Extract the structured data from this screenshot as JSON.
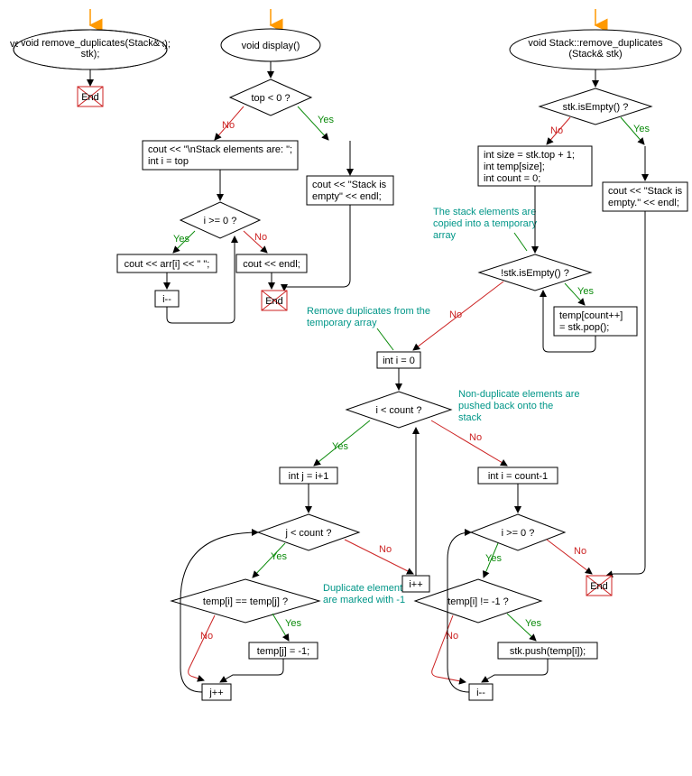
{
  "flowchart1": {
    "header": "void remove_duplicates(Stack& stk);",
    "end": "End"
  },
  "flowchart2": {
    "header": "void display()",
    "cond1": "top < 0 ?",
    "box_left": "cout << \"\\nStack elements are: \";\nint i = top",
    "box_right": "cout << \"Stack is empty\" << endl;",
    "cond2": "i >= 0 ?",
    "box_arr": "cout << arr[i] << \" \";",
    "box_dec": "i--",
    "box_endl": "cout << endl;",
    "end": "End",
    "yes": "Yes",
    "no": "No"
  },
  "flowchart3": {
    "header": "void Stack::remove_duplicates(Stack& stk)",
    "cond_empty": "stk.isEmpty() ?",
    "box_init": "int size = stk.top + 1;\nint temp[size];\nint count = 0;",
    "box_empty_msg": "cout << \"Stack is empty.\" << endl;",
    "comment_copy": "The stack elements are copied into a temporary array",
    "cond_pop": "!stk.isEmpty() ?",
    "box_pop": "temp[count++] = stk.pop();",
    "comment_remove": "Remove duplicates from the temporary array",
    "box_i0": "int i = 0",
    "cond_icount": "i < count ?",
    "comment_push": "Non-duplicate elements are pushed back onto the stack",
    "box_j": "int j = i+1",
    "cond_jcount": "j < count ?",
    "cond_eq": "temp[i] == temp[j] ?",
    "comment_mark": "Duplicate elements are marked with -1",
    "box_mark": "temp[j] = -1;",
    "box_jpp": "j++",
    "box_ipp": "i++",
    "box_i_count": "int i = count-1",
    "cond_i0": "i >= 0 ?",
    "cond_neg1": "temp[i] != -1 ?",
    "box_push": "stk.push(temp[i]);",
    "box_idec": "i--",
    "end": "End",
    "yes": "Yes",
    "no": "No"
  }
}
